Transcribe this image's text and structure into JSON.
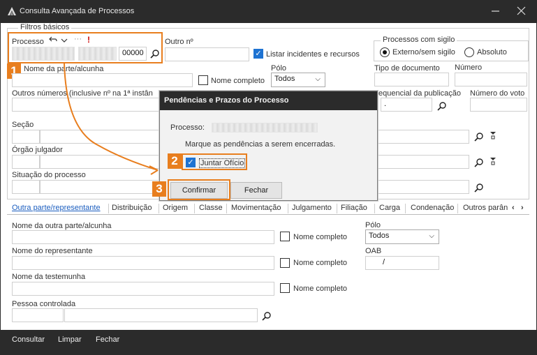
{
  "window": {
    "title": "Consulta Avançada de Processos"
  },
  "filters": {
    "group_label": "Filtros básicos",
    "processo_label": "Processo",
    "processo_suffix": "00000",
    "outro_no_label": "Outro nº",
    "listar_label": "Listar incidentes e recursos",
    "sigilo_label": "Processos com sigilo",
    "externo_label": "Externo/sem sigilo",
    "absoluto_label": "Absoluto",
    "nome_parte_label": "Nome da parte/alcunha",
    "nome_completo_label": "Nome completo",
    "polo_label": "Pólo",
    "polo_value": "Todos",
    "tipo_doc_label": "Tipo de documento",
    "numero_label": "Número",
    "outros_numeros_label": "Outros números (inclusive nº na 1ª instân",
    "sequencial_label": "equencial da publicação",
    "sequencial_value": ".",
    "numero_voto_label": "Número do voto",
    "secao_label": "Seção",
    "orgao_label": "Órgão julgador",
    "situacao_label": "Situação do processo"
  },
  "tabs": [
    "Outra parte/representante",
    "Distribuição",
    "Origem",
    "Classe",
    "Movimentação",
    "Julgamento",
    "Filiação",
    "Carga",
    "Condenação",
    "Outros parân"
  ],
  "tab_panel": {
    "nome_outra_parte_label": "Nome da outra parte/alcunha",
    "nome_completo_label": "Nome completo",
    "polo_label": "Pólo",
    "polo_value": "Todos",
    "nome_representante_label": "Nome do representante",
    "oab_label": "OAB",
    "oab_value": "/",
    "nome_testemunha_label": "Nome da testemunha",
    "pessoa_controlada_label": "Pessoa controlada"
  },
  "bottom": {
    "consultar": "Consultar",
    "limpar": "Limpar",
    "fechar": "Fechar"
  },
  "dialog": {
    "title": "Pendências e Prazos do Processo",
    "processo_label": "Processo:",
    "instruction": "Marque as pendências a serem encerradas.",
    "juntar_oficio": "Juntar Ofício",
    "confirmar": "Confirmar",
    "fechar": "Fechar"
  },
  "callouts": [
    "1",
    "2",
    "3"
  ],
  "colors": {
    "accent": "#e87e1e",
    "titlebar": "#2b2b2b",
    "check": "#1e73d2",
    "active_tab": "#1a5dbf"
  }
}
